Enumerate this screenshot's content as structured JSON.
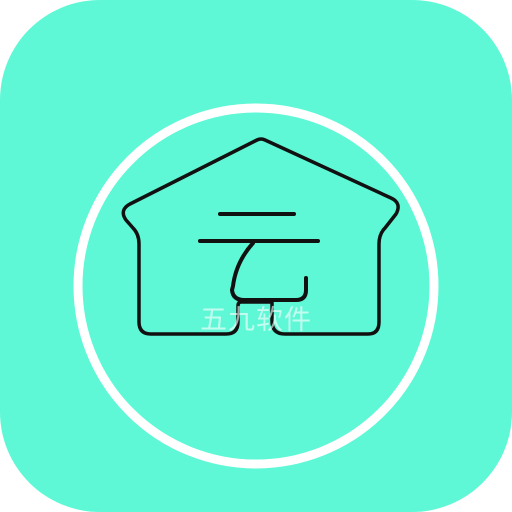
{
  "app_icon": {
    "background_color": "#5ef8d6",
    "ring_color": "#ffffff",
    "stroke_color": "#111111",
    "icon_name": "cloud-house-icon"
  },
  "watermark": {
    "text": "五九软件"
  }
}
